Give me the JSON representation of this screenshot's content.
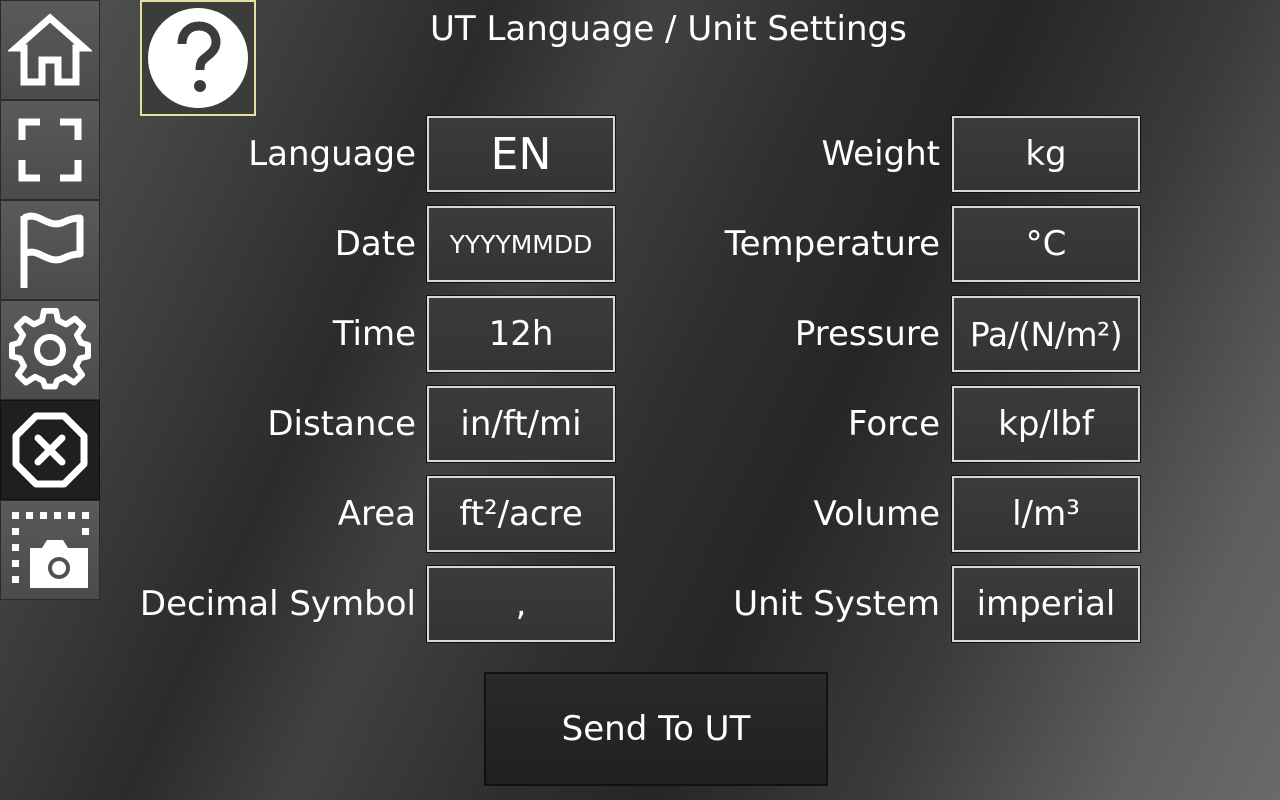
{
  "title": "UT Language / Unit Settings",
  "sidebar": {
    "items": [
      {
        "icon": "home-icon"
      },
      {
        "icon": "fullscreen-icon"
      },
      {
        "icon": "flag-icon"
      },
      {
        "icon": "gear-icon"
      },
      {
        "icon": "close-octagon-icon",
        "active": true
      },
      {
        "icon": "screenshot-camera-icon"
      }
    ]
  },
  "help": {
    "icon": "help-icon"
  },
  "settings": {
    "left": [
      {
        "label": "Language",
        "value": "EN"
      },
      {
        "label": "Date",
        "value": "YYYYMMDD"
      },
      {
        "label": "Time",
        "value": "12h"
      },
      {
        "label": "Distance",
        "value": "in/ft/mi"
      },
      {
        "label": "Area",
        "value": "ft²/acre"
      },
      {
        "label": "Decimal Symbol",
        "value": ","
      }
    ],
    "right": [
      {
        "label": "Weight",
        "value": "kg"
      },
      {
        "label": "Temperature",
        "value": "°C"
      },
      {
        "label": "Pressure",
        "value": "Pa/(N/m²)"
      },
      {
        "label": "Force",
        "value": "kp/lbf"
      },
      {
        "label": "Volume",
        "value": "l/m³"
      },
      {
        "label": "Unit System",
        "value": "imperial"
      }
    ]
  },
  "send_button": {
    "label": "Send To UT"
  },
  "colors": {
    "help_border": "#e8e0a0",
    "box_border": "#d8d8d8",
    "text": "#ffffff"
  }
}
